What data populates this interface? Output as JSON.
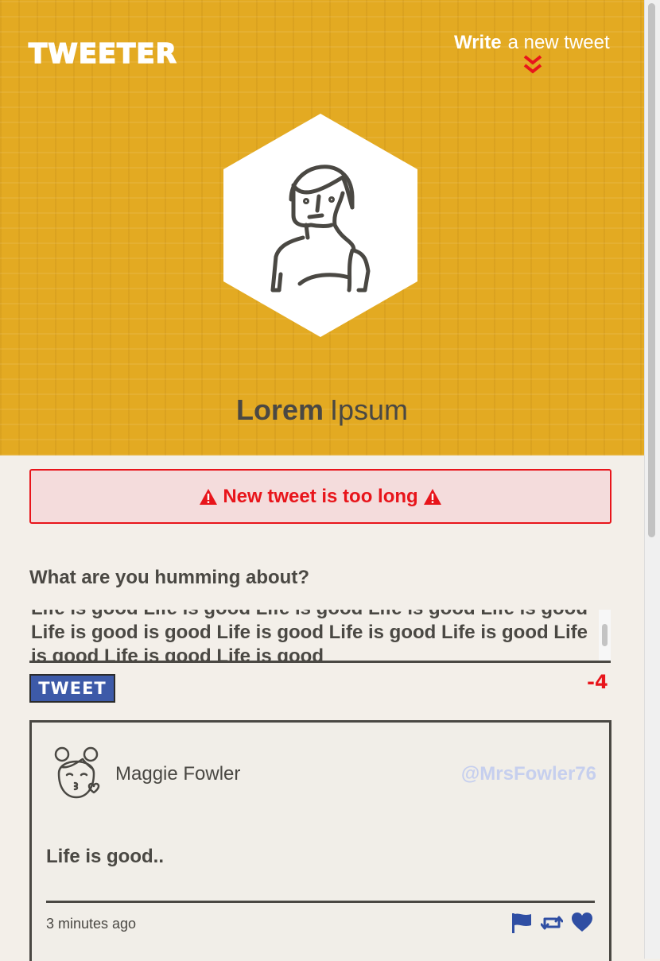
{
  "header": {
    "logo": "TWEETER",
    "compose_strong": "Write",
    "compose_rest": "a new tweet",
    "chevron_icon": "double-chevron-down-icon"
  },
  "profile": {
    "first_name": "Lorem",
    "last_name": "Ipsum",
    "avatar_icon": "woman-avatar-icon"
  },
  "error": {
    "message": "New tweet is too long",
    "icon": "warning-triangle-icon",
    "color": "#e8151b"
  },
  "compose": {
    "label": "What are you humming about?",
    "value": "Life is good Life is good Life is good Life is good Life is good Life is good is good Life is good Life is good Life is good Life is good Life is good Life is good",
    "button_label": "TWEET",
    "counter": "-4"
  },
  "tweet": {
    "name": "Maggie Fowler",
    "handle": "@MrsFowler76",
    "content": "Life is good..",
    "time": "3 minutes ago",
    "avatar_icon": "girl-kiss-avatar-icon",
    "actions": [
      "flag-icon",
      "retweet-icon",
      "heart-icon"
    ]
  },
  "colors": {
    "banner": "#e3aa22",
    "text": "#4a4843",
    "button": "#3d5aa8",
    "handle": "#c6cfee",
    "action": "#2f4ea3"
  }
}
